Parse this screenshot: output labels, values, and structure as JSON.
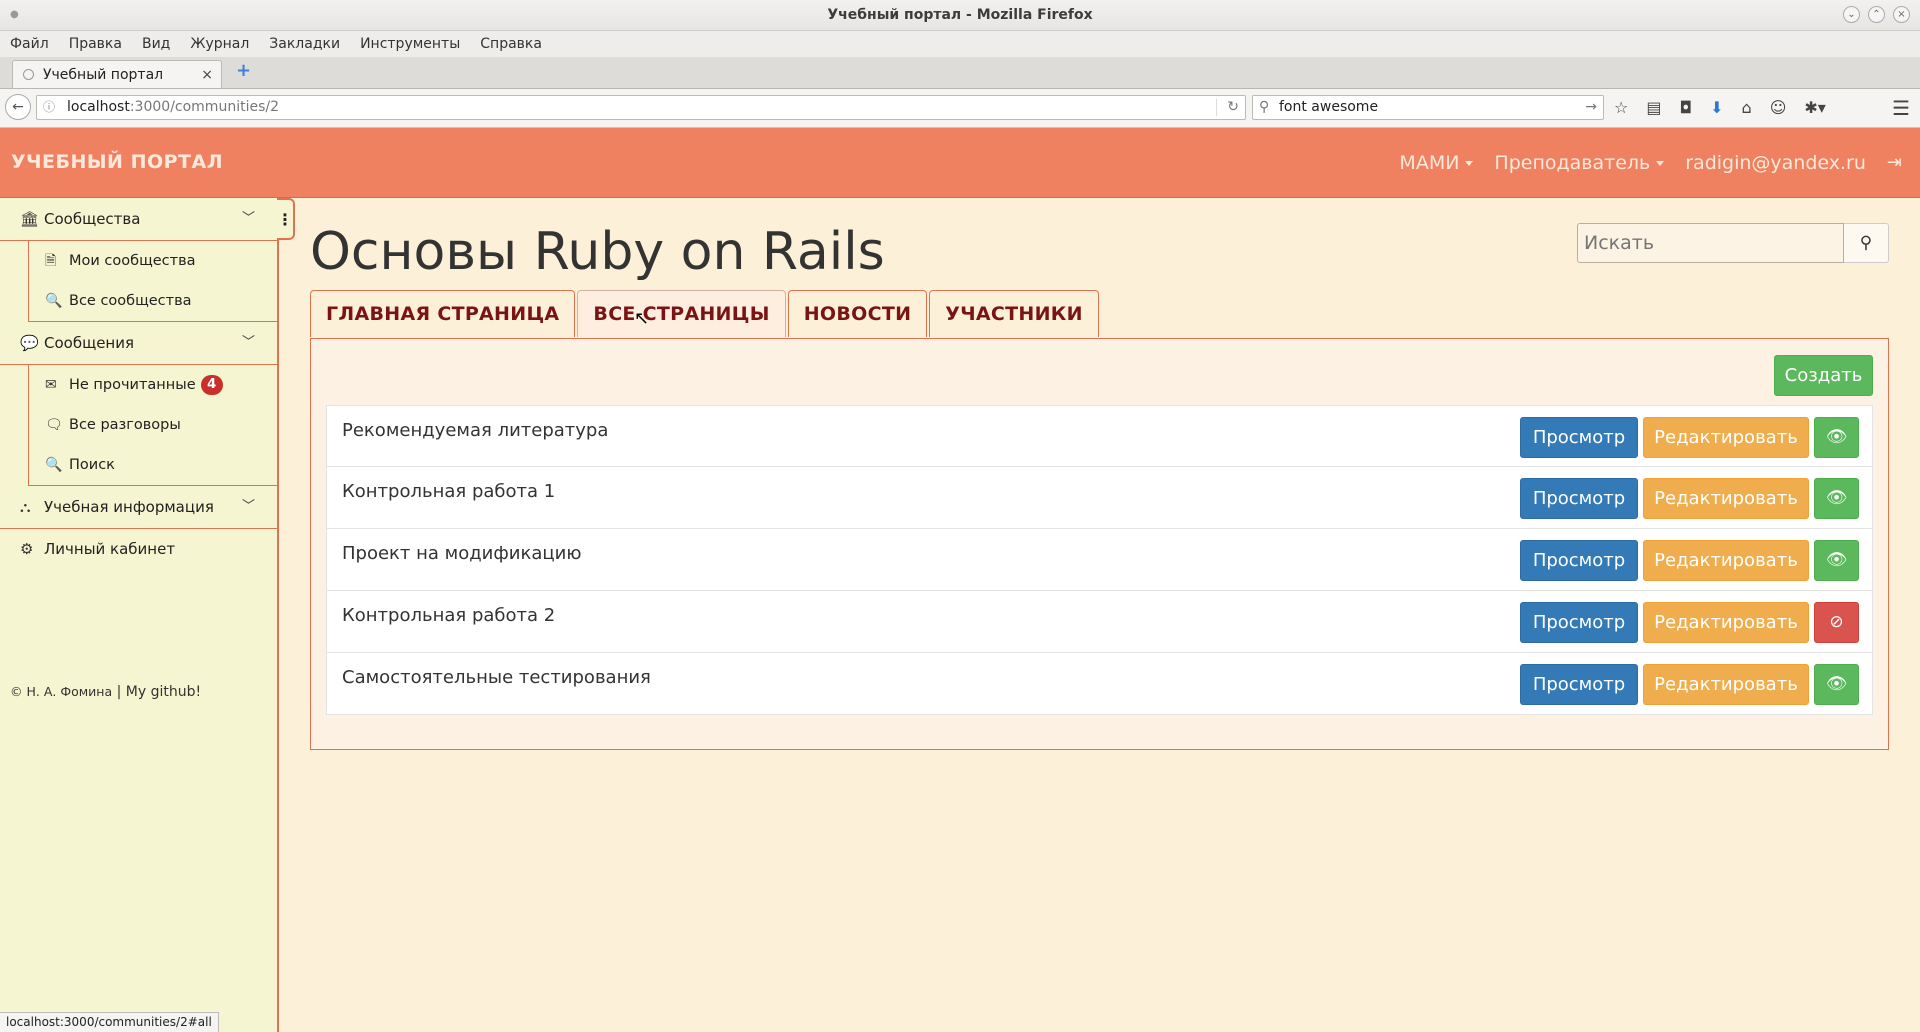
{
  "window": {
    "title": "Учебный портал - Mozilla Firefox"
  },
  "menu": [
    "Файл",
    "Правка",
    "Вид",
    "Журнал",
    "Закладки",
    "Инструменты",
    "Справка"
  ],
  "tab": {
    "title": "Учебный портал",
    "close": "×",
    "new_tab": "+"
  },
  "urlbar": {
    "host": "localhost",
    "path": ":3000/communities/2"
  },
  "searchbar": {
    "value": "font awesome"
  },
  "app": {
    "brand": "УЧЕБНЫЙ ПОРТАЛ",
    "nav": {
      "org": "МАМИ",
      "role": "Преподаватель",
      "user": "radigin@yandex.ru"
    }
  },
  "sidebar": {
    "communities": {
      "label": "Сообщества",
      "items": [
        "Мои сообщества",
        "Все сообщества"
      ]
    },
    "messages": {
      "label": "Сообщения",
      "unread_label": "Не прочитанные",
      "unread_count": "4",
      "all_label": "Все разговоры",
      "search_label": "Поиск"
    },
    "study_info": {
      "label": "Учебная информация"
    },
    "account": {
      "label": "Личный кабинет"
    },
    "footer": {
      "copyright": "© Н. А. Фомина",
      "separator": " | ",
      "github": "My github!"
    }
  },
  "main": {
    "title": "Основы Ruby on Rails",
    "search_placeholder": "Искать",
    "tabs": [
      "ГЛАВНАЯ СТРАНИЦА",
      "ВСЕ СТРАНИЦЫ",
      "НОВОСТИ",
      "УЧАСТНИКИ"
    ],
    "active_tab": "ВСЕ СТРАНИЦЫ",
    "create_label": "Создать",
    "view_label": "Просмотр",
    "edit_label": "Редактировать",
    "pages": [
      {
        "title": "Рекомендуемая литература",
        "visible": true
      },
      {
        "title": "Контрольная работа 1",
        "visible": true
      },
      {
        "title": "Проект на модификацию",
        "visible": true
      },
      {
        "title": "Контрольная работа 2",
        "visible": false
      },
      {
        "title": "Самостоятельные тестирования",
        "visible": true
      }
    ]
  },
  "status_url": "localhost:3000/communities/2#all",
  "colors": {
    "navbar": "#ef8160",
    "sidebar": "#f6f5d2",
    "page_bg": "#fdf0d8",
    "primary": "#337ab7",
    "warning": "#f0ad4e",
    "success": "#5cb85c",
    "danger": "#d9534f",
    "tab_text": "#7a1414"
  }
}
